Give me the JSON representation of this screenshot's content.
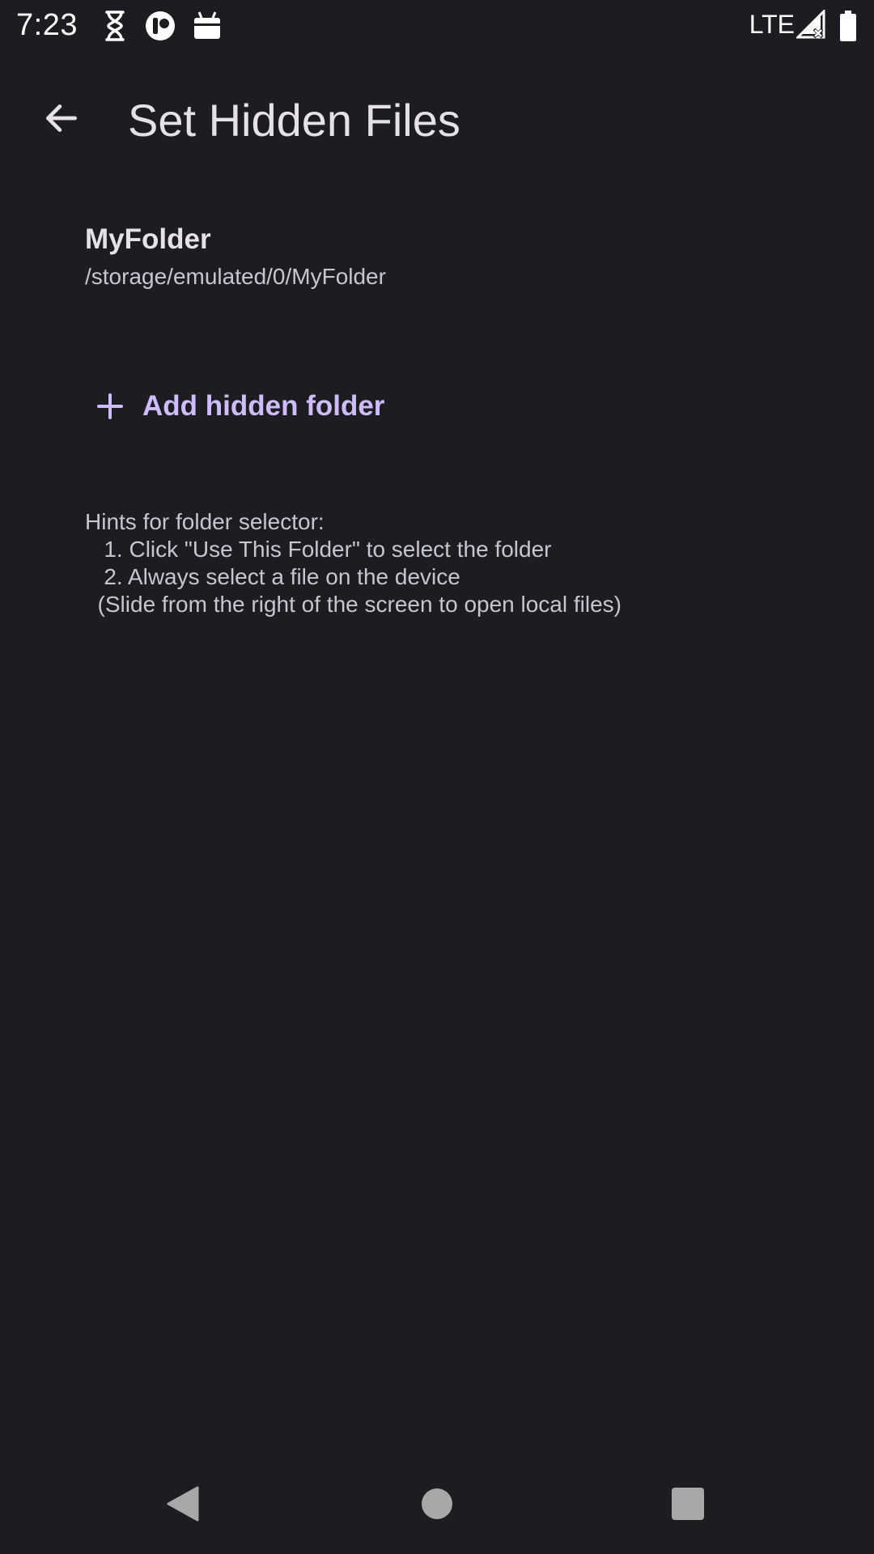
{
  "status_bar": {
    "time": "7:23",
    "network": "LTE",
    "icons": [
      "hourglass-icon",
      "app-circle-icon",
      "android-icon",
      "signal-icon",
      "battery-icon"
    ]
  },
  "app_bar": {
    "title": "Set Hidden Files",
    "back_icon": "arrow-back-icon"
  },
  "folder_item": {
    "name": "MyFolder",
    "path": "/storage/emulated/0/MyFolder"
  },
  "add_button": {
    "label": "Add hidden folder",
    "icon": "plus-icon"
  },
  "hints": {
    "line1": "Hints for folder selector:",
    "line2": "   1. Click \"Use This Folder\" to select the folder",
    "line3": "   2. Always select a file on the device",
    "line4": "  (Slide from the right of the screen to open local files)"
  },
  "nav_bar": {
    "icons": [
      "nav-back-icon",
      "nav-home-icon",
      "nav-recents-icon"
    ]
  },
  "colors": {
    "background": "#1d1c21",
    "accent": "#cfbcff",
    "text_primary": "#e6e1e6",
    "text_secondary": "#cac4d0"
  }
}
